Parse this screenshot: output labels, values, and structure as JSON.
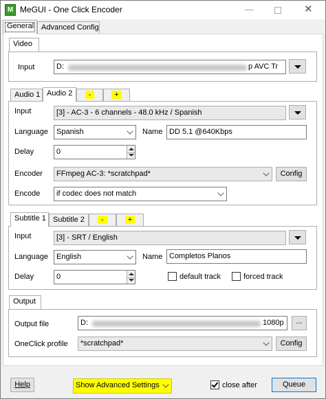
{
  "window": {
    "title": "MeGUI - One Click Encoder",
    "icon_letter": "M",
    "min_glyph": "—",
    "close_glyph": "✕"
  },
  "main_tabs": [
    "General",
    "Advanced Config"
  ],
  "video": {
    "tab": "Video",
    "input_label": "Input",
    "input_prefix": "D:",
    "input_suffix": "p AVC Tr"
  },
  "audio": {
    "tabs": [
      "Audio 1",
      "Audio 2",
      "-",
      "+"
    ],
    "input_label": "Input",
    "input_value": "[3] - AC-3 - 6 channels - 48.0 kHz / Spanish",
    "language_label": "Language",
    "language_value": "Spanish",
    "name_label": "Name",
    "name_value": "DD 5.1 @640Kbps",
    "delay_label": "Delay",
    "delay_value": "0",
    "encoder_label": "Encoder",
    "encoder_value": "FFmpeg AC-3: *scratchpad*",
    "config_label": "Config",
    "encode_label": "Encode",
    "encode_value": "if codec does not match"
  },
  "subtitle": {
    "tabs": [
      "Subtitle 1",
      "Subtitle 2",
      "-",
      "+"
    ],
    "input_label": "Input",
    "input_value": "[3] - SRT / English",
    "language_label": "Language",
    "language_value": "English",
    "name_label": "Name",
    "name_value": "Completos Planos",
    "delay_label": "Delay",
    "delay_value": "0",
    "default_track_label": "default track",
    "forced_track_label": "forced track"
  },
  "output": {
    "tab": "Output",
    "file_label": "Output file",
    "file_prefix": "D:",
    "file_suffix": "1080p",
    "browse_label": "...",
    "profile_label": "OneClick profile",
    "profile_value": "*scratchpad*",
    "config_label": "Config"
  },
  "footer": {
    "help_label": "Help",
    "advanced_settings_label": "Show Advanced Settings",
    "close_after_label": "close after",
    "queue_label": "Queue"
  },
  "colors": {
    "highlight": "#ffff00"
  }
}
